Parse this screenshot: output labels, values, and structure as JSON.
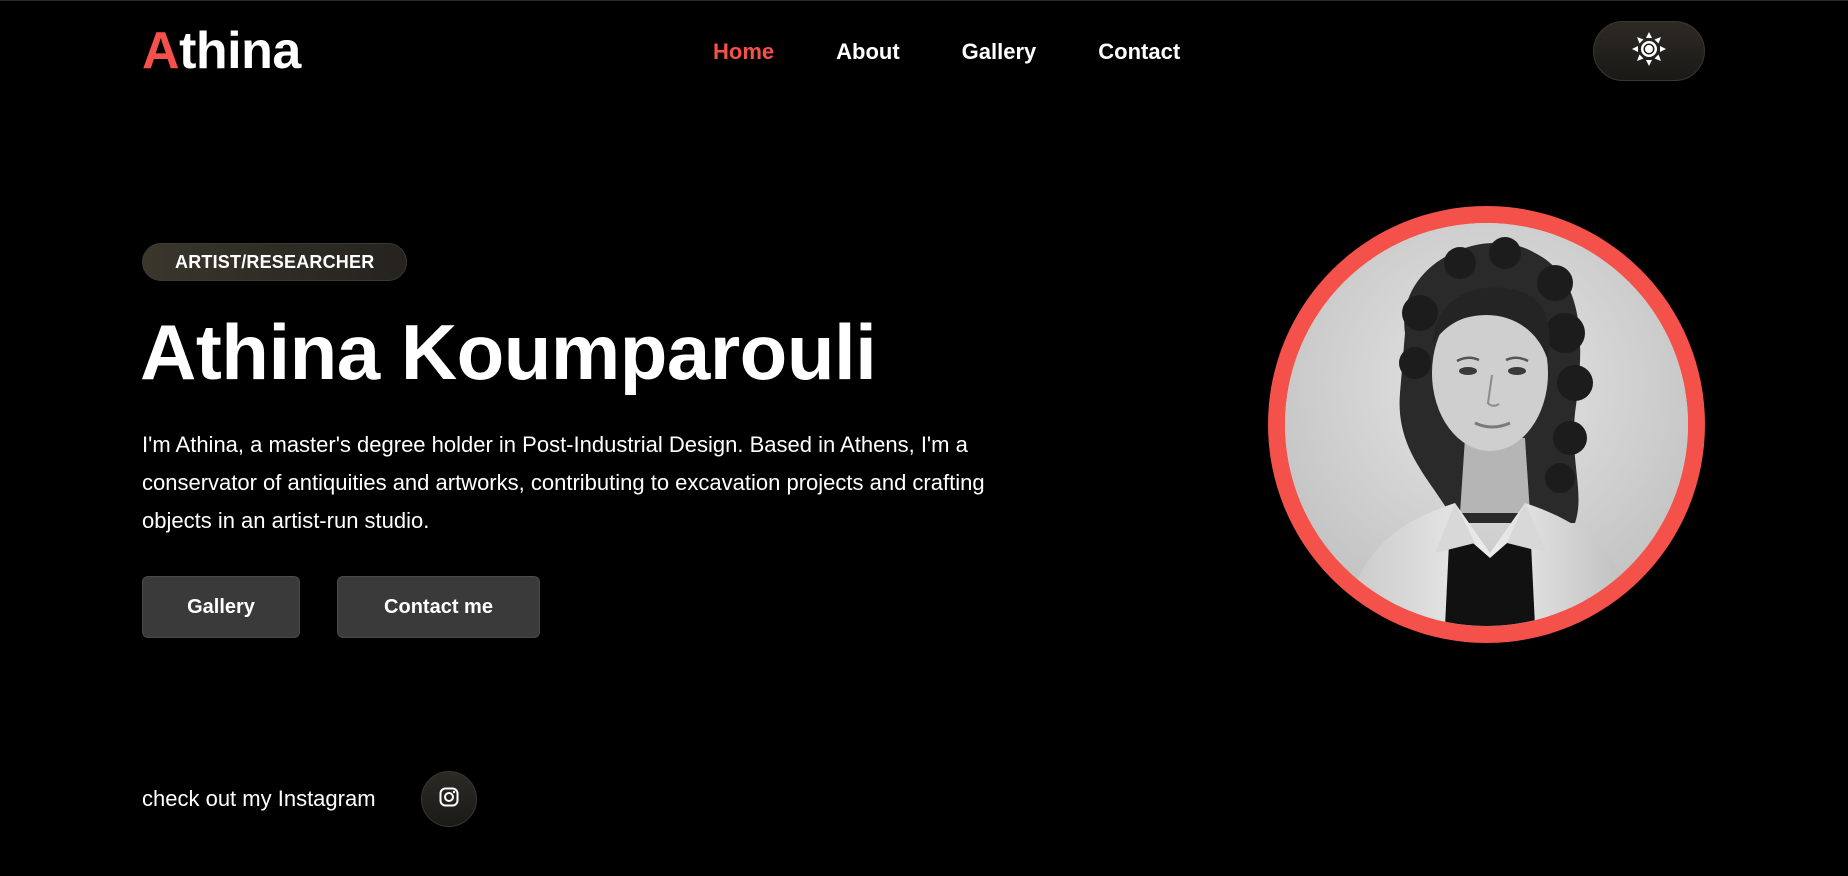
{
  "brand": {
    "logo_first_letter": "A",
    "logo_rest": "thina",
    "accent_color": "#f4514b"
  },
  "nav": {
    "items": [
      {
        "label": "Home",
        "active": true
      },
      {
        "label": "About",
        "active": false
      },
      {
        "label": "Gallery",
        "active": false
      },
      {
        "label": "Contact",
        "active": false
      }
    ]
  },
  "theme_toggle": {
    "icon": "sun-icon"
  },
  "hero": {
    "badge": "ARTIST/RESEARCHER",
    "name": "Athina Koumparouli",
    "bio": "I'm Athina, a master's degree holder in Post-Industrial Design. Based in Athens, I'm a conservator of antiquities and artworks, contributing to excavation projects and crafting objects in an artist-run studio.",
    "buttons": {
      "gallery": "Gallery",
      "contact": "Contact me"
    }
  },
  "instagram": {
    "label": "check out my Instagram",
    "icon": "instagram-icon"
  },
  "portrait": {
    "ring_color": "#f4514b"
  }
}
